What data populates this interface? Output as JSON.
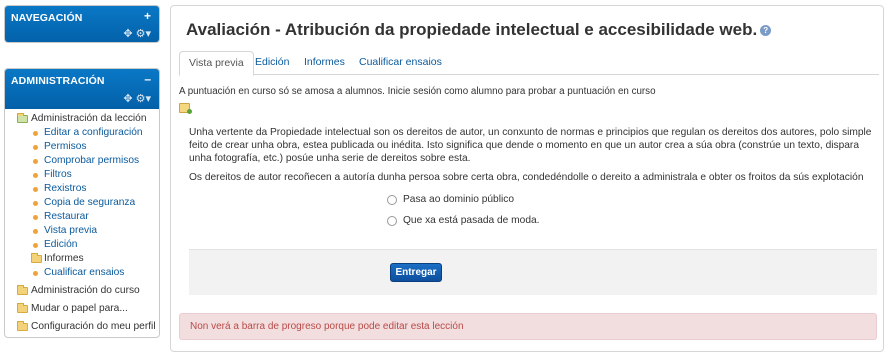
{
  "navigation_block": {
    "title": "NAVEGACIÓN",
    "toggle": "+",
    "controls": [
      "move-icon",
      "gear-icon",
      "chevron-down-icon"
    ]
  },
  "admin_block": {
    "title": "ADMINISTRACIÓN",
    "toggle": "–",
    "items": {
      "lesson_admin": "Administración da lección",
      "edit_settings": "Editar a configuración",
      "permissions": "Permisos",
      "check_permissions": "Comprobar permisos",
      "filters": "Filtros",
      "logs": "Rexistros",
      "backup": "Copia de seguranza",
      "restore": "Restaurar",
      "preview": "Vista previa",
      "edit": "Edición",
      "reports": "Informes",
      "grade_essays": "Cualificar ensaios",
      "course_admin": "Administración do curso",
      "switch_role": "Mudar o papel para...",
      "profile_settings": "Configuración do meu perfil"
    }
  },
  "main": {
    "title": "Avaliación - Atribución da propiedade intelectual e accesibilidade web.",
    "help_icon": "?",
    "tabs": [
      "Vista previa",
      "Edición",
      "Informes",
      "Cualificar ensaios"
    ],
    "active_tab": "Vista previa",
    "notice": "A puntuación en curso só se amosa a alumnos. Inicie sesión como alumno para probar a puntuación en curso",
    "question": {
      "paragraph1": "Unha vertente da Propiedade intelectual son os dereitos de autor, un conxunto de normas e principios que regulan os dereitos dos autores, polo simple feito de crear unha obra, estea publicada ou inédita. Isto significa que dende o momento en que un autor crea a súa obra (constrúe un texto, dispara unha fotografía, etc.) posúe unha serie de dereitos sobre esta.",
      "paragraph2": "Os dereitos de autor recoñecen a autoría dunha persoa sobre certa obra, condedéndolle o dereito a administrala e obter os froitos da sús explotación",
      "options": [
        "Pasa ao dominio público",
        "Que xa está pasada de moda."
      ]
    },
    "submit_label": "Entregar",
    "progress_alert": "Non verá a barra de progreso porque pode editar esta lección"
  },
  "colors": {
    "block_header": "#0a6fbf",
    "link": "#0a5a9c",
    "alert_bg": "#f2dede",
    "alert_text": "#b94a48",
    "submit_button": "#0e4f9e"
  }
}
